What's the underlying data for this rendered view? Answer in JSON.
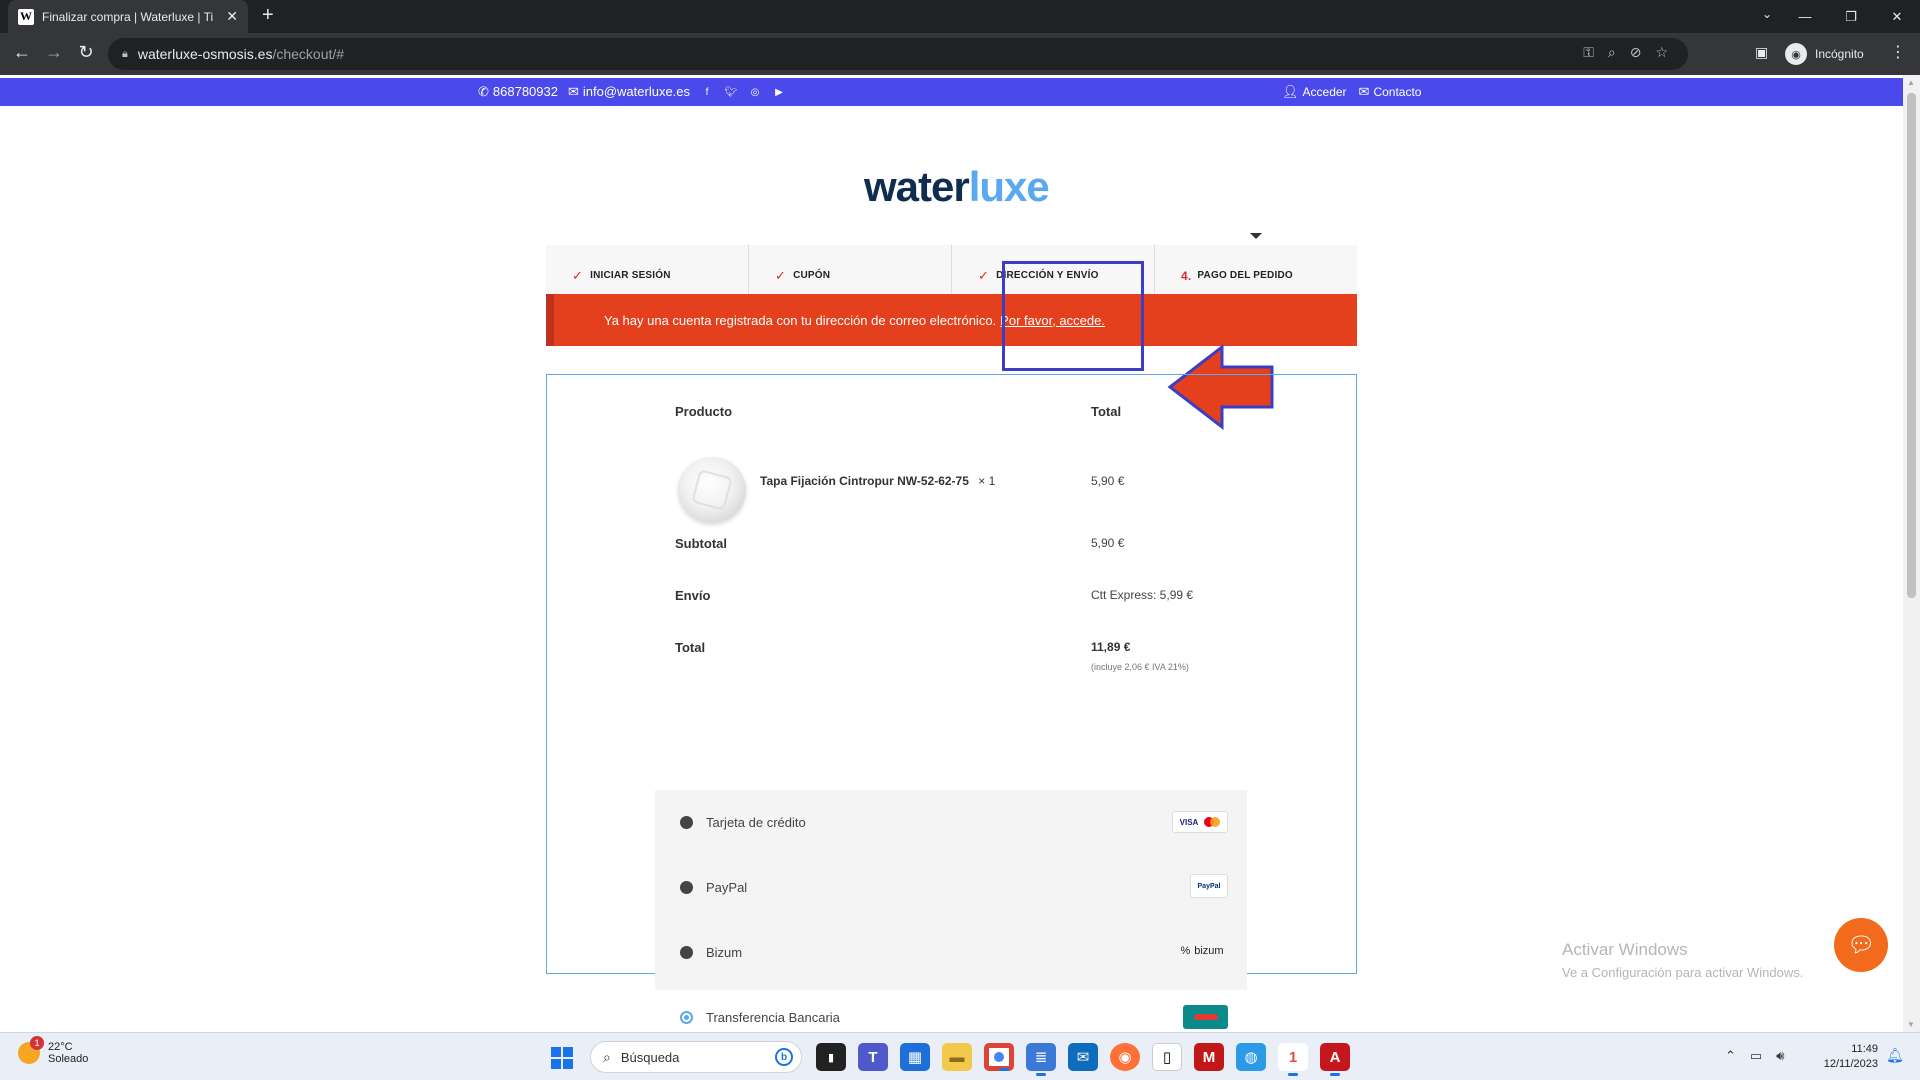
{
  "browser": {
    "tab_title": "Finalizar compra | Waterluxe | Ti",
    "tab_favicon": "W",
    "url_host": "waterluxe-osmosis.es",
    "url_path": "/checkout/#",
    "profile_label": "Incógnito"
  },
  "topbar": {
    "phone": "868780932",
    "email": "info@waterluxe.es",
    "login": "Acceder",
    "contact": "Contacto"
  },
  "logo": {
    "part1": "water",
    "part2": "luxe"
  },
  "steps": [
    {
      "mark": "✓",
      "label": "INICIAR SESIÓN"
    },
    {
      "mark": "✓",
      "label": "CUPÓN"
    },
    {
      "mark": "✓",
      "label": "DIRECCIÓN Y ENVÍO"
    },
    {
      "mark": "4.",
      "label": "PAGO DEL PEDIDO"
    }
  ],
  "alert": {
    "text": "Ya hay una cuenta registrada con tu dirección de correo electrónico.",
    "link": "Por favor, accede."
  },
  "order": {
    "col_product": "Producto",
    "col_total": "Total",
    "product_name": "Tapa Fijación Cintropur NW-52-62-75",
    "product_qty": "× 1",
    "product_price": "5,90 €",
    "subtotal_label": "Subtotal",
    "subtotal_value": "5,90 €",
    "shipping_label": "Envío",
    "shipping_value": "Ctt Express: 5,99 €",
    "total_label": "Total",
    "total_value": "11,89 €",
    "total_tax_note": "(incluye 2,06 € IVA 21%)"
  },
  "payment": {
    "methods": [
      {
        "label": "Tarjeta de crédito",
        "logo": "VISA"
      },
      {
        "label": "PayPal",
        "logo": "PayPal"
      },
      {
        "label": "Bizum",
        "logo": "bizum"
      },
      {
        "label": "Transferencia Bancaria",
        "logo": ""
      }
    ],
    "selected": "Transferencia Bancaria"
  },
  "overlay": {
    "activate_title": "Activar Windows",
    "activate_sub": "Ve a Configuración para activar Windows."
  },
  "taskbar": {
    "temperature": "22°C",
    "weather": "Soleado",
    "weather_badge": "1",
    "search_placeholder": "Búsqueda",
    "time": "11:49",
    "date": "12/11/2023"
  },
  "colors": {
    "topbar": "#4a4aec",
    "alert": "#e5401e",
    "annotation": "#3d3dc4",
    "logo_dark": "#0f2e4f",
    "logo_light": "#5aa8f0",
    "chat": "#f26a1b"
  }
}
